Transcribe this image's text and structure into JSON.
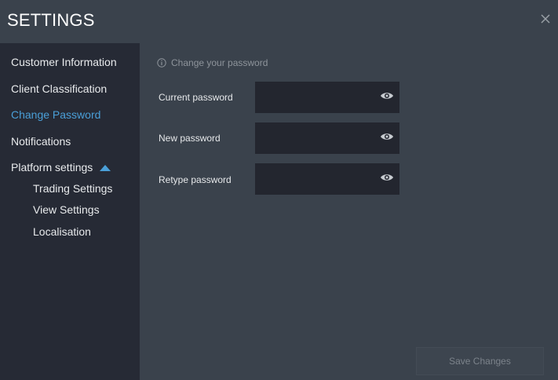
{
  "header": {
    "title": "SETTINGS",
    "close_icon": "close-icon"
  },
  "sidebar": {
    "items": [
      {
        "label": "Customer Information"
      },
      {
        "label": "Client Classification"
      },
      {
        "label": "Change Password",
        "active": true
      },
      {
        "label": "Notifications"
      },
      {
        "label": "Platform settings",
        "expanded": true
      }
    ],
    "subitems": [
      {
        "label": "Trading Settings"
      },
      {
        "label": "View Settings"
      },
      {
        "label": "Localisation"
      }
    ]
  },
  "main": {
    "hint": "Change your password",
    "fields": [
      {
        "label": "Current password",
        "value": ""
      },
      {
        "label": "New password",
        "value": ""
      },
      {
        "label": "Retype password",
        "value": ""
      }
    ],
    "save_label": "Save Changes"
  },
  "colors": {
    "accent": "#4a9fd8",
    "sidebar_bg": "#262a35",
    "main_bg": "#3a424c",
    "input_bg": "#23262f"
  }
}
